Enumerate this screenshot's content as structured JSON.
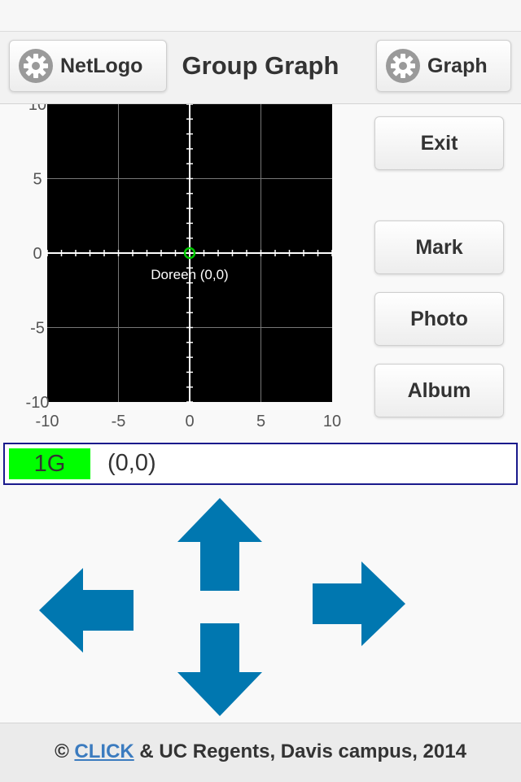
{
  "header": {
    "title": "Group Graph",
    "left_button": "NetLogo",
    "right_button": "Graph"
  },
  "graph": {
    "x_ticks": [
      "-10",
      "-5",
      "0",
      "5",
      "10"
    ],
    "y_ticks": [
      "10",
      "5",
      "0",
      "-5",
      "-10"
    ],
    "point_label": "Doreen (0,0)",
    "point": {
      "x": 0,
      "y": 0
    },
    "xlim": [
      -10,
      10
    ],
    "ylim": [
      -10,
      10
    ],
    "background_color": "#000000",
    "axis_color": "#ffffff",
    "point_color": "#00cc00"
  },
  "side_buttons": {
    "exit": "Exit",
    "mark": "Mark",
    "photo": "Photo",
    "album": "Album"
  },
  "position_bar": {
    "group": "1G",
    "coordinates": "(0,0)",
    "group_color": "#00ff00"
  },
  "arrows": {
    "color": "#0077b0",
    "icons": [
      "arrow-up-icon",
      "arrow-left-icon",
      "arrow-right-icon",
      "arrow-down-icon"
    ]
  },
  "footer": {
    "prefix": "© ",
    "link": "CLICK",
    "suffix": " & UC Regents, Davis campus, 2014"
  }
}
